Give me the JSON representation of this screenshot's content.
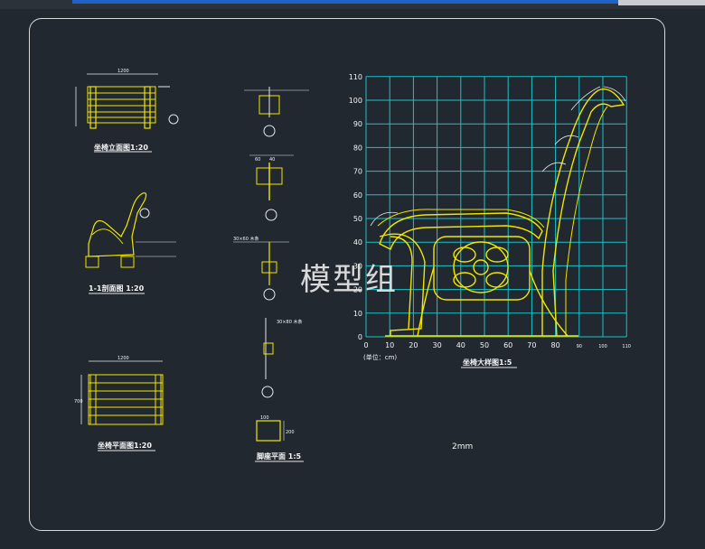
{
  "drawing": {
    "elevation_title": "坐椅立面图1:20",
    "section_title": "1-1剖面图 1:20",
    "plan_title": "坐椅平面图1:20",
    "foot_plan_title": "脚座平面 1:5",
    "detail_title": "坐椅大样图1:5",
    "unit_label": "(单位：cm)",
    "scale_note": "2mm",
    "watermark": "模型组",
    "dim_1200_a": "1200",
    "dim_1200_b": "1200",
    "dim_700": "700",
    "dim_100": "100",
    "dim_200": "200",
    "dim_40": "40",
    "dim_60": "60",
    "dim_30x60": "30×60 木条",
    "dim_30x80": "30×80 木条"
  },
  "grid": {
    "y_ticks": [
      "110",
      "100",
      "90",
      "80",
      "70",
      "60",
      "50",
      "40",
      "30",
      "20",
      "10",
      "0"
    ],
    "x_ticks": [
      "0",
      "10",
      "20",
      "30",
      "40",
      "50",
      "60",
      "70",
      "80",
      "90",
      "100",
      "110"
    ]
  },
  "colors": {
    "background": "#212830",
    "drawing": "#f2e600",
    "grid": "#19c3c8",
    "text": "#f5f5f5"
  }
}
